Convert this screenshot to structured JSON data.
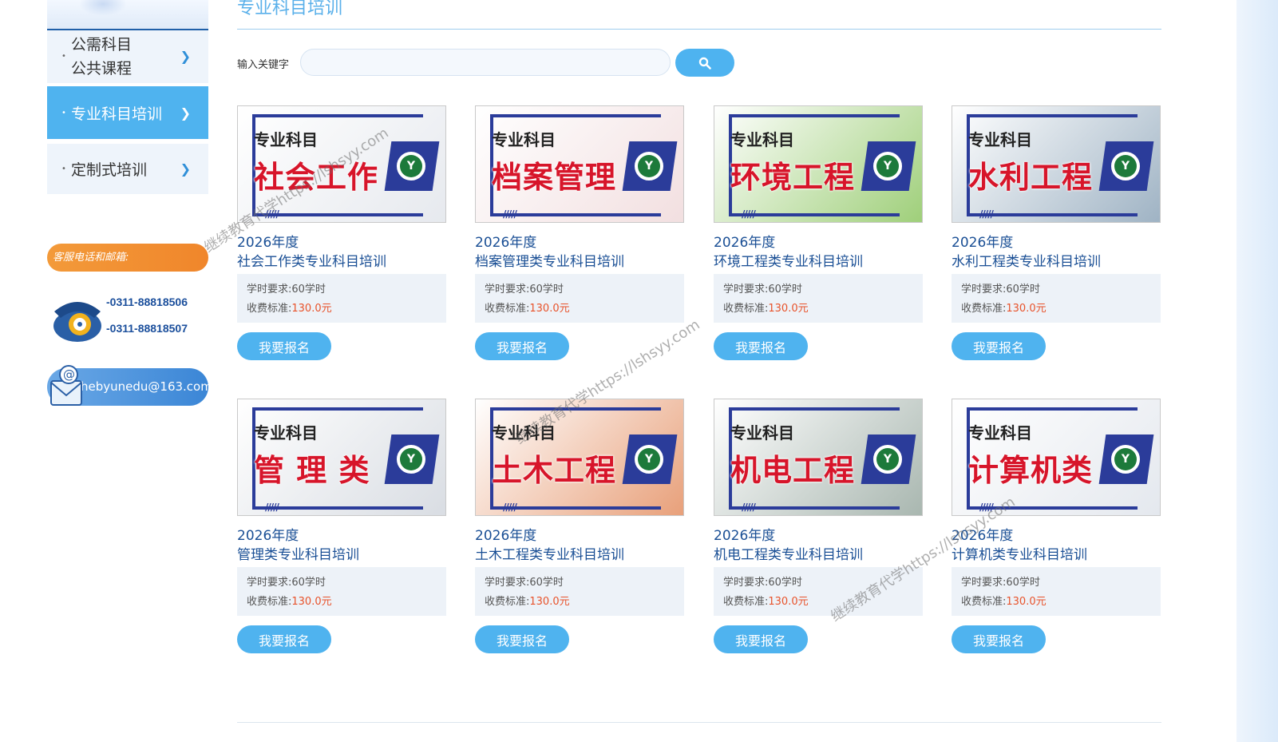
{
  "sidebar": {
    "items": [
      {
        "line1": "公需科目",
        "line2": "公共课程"
      },
      {
        "label": "专业科目培训"
      },
      {
        "label": "定制式培训"
      }
    ],
    "contact_title": "客服电话和邮箱:",
    "phone1": "-0311-88818506",
    "phone2": "-0311-88818507",
    "email": "hebyunedu@163.com"
  },
  "main": {
    "title": "专业科目培训",
    "search": {
      "label": "输入关键字",
      "placeholder": "",
      "value": ""
    }
  },
  "courses": [
    {
      "top": "专业科目",
      "big": "社会工作",
      "year": "2026年度",
      "name": "社会工作类专业科目培训",
      "hours_label": "学时要求:",
      "hours": "60学时",
      "fee_label": "收费标准:",
      "fee": "130.0元",
      "enroll": "我要报名",
      "bg": "#e6e9ee"
    },
    {
      "top": "专业科目",
      "big": "档案管理",
      "year": "2026年度",
      "name": "档案管理类专业科目培训",
      "hours_label": "学时要求:",
      "hours": "60学时",
      "fee_label": "收费标准:",
      "fee": "130.0元",
      "enroll": "我要报名",
      "bg": "#f2dfe0"
    },
    {
      "top": "专业科目",
      "big": "环境工程",
      "year": "2026年度",
      "name": "环境工程类专业科目培训",
      "hours_label": "学时要求:",
      "hours": "60学时",
      "fee_label": "收费标准:",
      "fee": "130.0元",
      "enroll": "我要报名",
      "bg": "#9fcf7a"
    },
    {
      "top": "专业科目",
      "big": "水利工程",
      "year": "2026年度",
      "name": "水利工程类专业科目培训",
      "hours_label": "学时要求:",
      "hours": "60学时",
      "fee_label": "收费标准:",
      "fee": "130.0元",
      "enroll": "我要报名",
      "bg": "#9fb3c4"
    },
    {
      "top": "专业科目",
      "big": "管 理 类",
      "year": "2026年度",
      "name": "管理类专业科目培训",
      "hours_label": "学时要求:",
      "hours": "60学时",
      "fee_label": "收费标准:",
      "fee": "130.0元",
      "enroll": "我要报名",
      "bg": "#d9dde3"
    },
    {
      "top": "专业科目",
      "big": "土木工程",
      "year": "2026年度",
      "name": "土木工程类专业科目培训",
      "hours_label": "学时要求:",
      "hours": "60学时",
      "fee_label": "收费标准:",
      "fee": "130.0元",
      "enroll": "我要报名",
      "bg": "#e8a07a"
    },
    {
      "top": "专业科目",
      "big": "机电工程",
      "year": "2026年度",
      "name": "机电工程类专业科目培训",
      "hours_label": "学时要求:",
      "hours": "60学时",
      "fee_label": "收费标准:",
      "fee": "130.0元",
      "enroll": "我要报名",
      "bg": "#a9b7b0"
    },
    {
      "top": "专业科目",
      "big": "计算机类",
      "year": "2026年度",
      "name": "计算机类专业科目培训",
      "hours_label": "学时要求:",
      "hours": "60学时",
      "fee_label": "收费标准:",
      "fee": "130.0元",
      "enroll": "我要报名",
      "bg": "#e4e8ee"
    }
  ],
  "watermark": "继续教育代学https://lshsyy.com"
}
